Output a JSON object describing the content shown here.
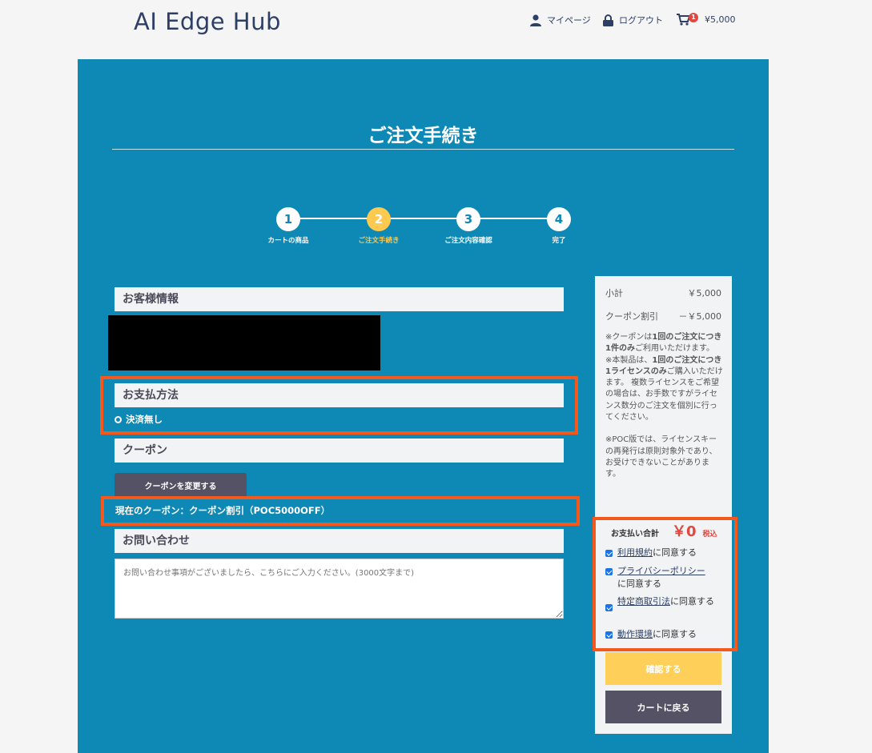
{
  "header": {
    "logo": "AI Edge Hub",
    "mypage": "マイページ",
    "logout": "ログアウト",
    "cart_count": "1",
    "cart_total": "¥5,000"
  },
  "page_title": "ご注文手続き",
  "steps": [
    {
      "num": "1",
      "label": "カートの商品"
    },
    {
      "num": "2",
      "label": "ご注文手続き"
    },
    {
      "num": "3",
      "label": "ご注文内容確認"
    },
    {
      "num": "4",
      "label": "完了"
    }
  ],
  "active_step": 2,
  "sections": {
    "customer": "お客様情報",
    "payment": "お支払方法",
    "coupon": "クーポン",
    "inquiry": "お問い合わせ"
  },
  "payment_option": "決済無し",
  "coupon_button": "クーポンを変更する",
  "current_coupon": "現在のクーポン：クーポン割引（POC5000OFF）",
  "inquiry_placeholder": "お問い合わせ事項がございましたら、こちらにご入力ください。(3000文字まで)",
  "summary": {
    "subtotal_label": "小計",
    "subtotal_value": "￥5,000",
    "discount_label": "クーポン割引",
    "discount_value": "－￥5,000",
    "note1_a": "※クーポンは",
    "note1_b": "1回のご注文につき1件のみ",
    "note1_c": "ご利用いただけます。",
    "note2_a": "※本製品は、",
    "note2_b": "1回のご注文につき1ライセンスのみ",
    "note2_c": "ご購入いただけます。 複数ライセンスをご希望の場合は、お手数ですがライセンス数分のご注文を個別に行ってください。",
    "note3": "※POC版では、ライセンスキーの再発行は原則対象外であり、お受けできないことがあります。",
    "total_label": "お支払い合計",
    "total_value": "￥0",
    "tax_label": "税込",
    "agree_terms_link": "利用規約",
    "agree_terms_text": "に同意する",
    "agree_privacy_link": "プライバシーポリシー",
    "agree_privacy_text": "に同意する",
    "agree_commerce_link": "特定商取引法",
    "agree_commerce_text": "に同意する",
    "agree_env_link": "動作環境",
    "agree_env_text": "に同意する",
    "confirm_button": "確認する",
    "back_button": "カートに戻る"
  }
}
